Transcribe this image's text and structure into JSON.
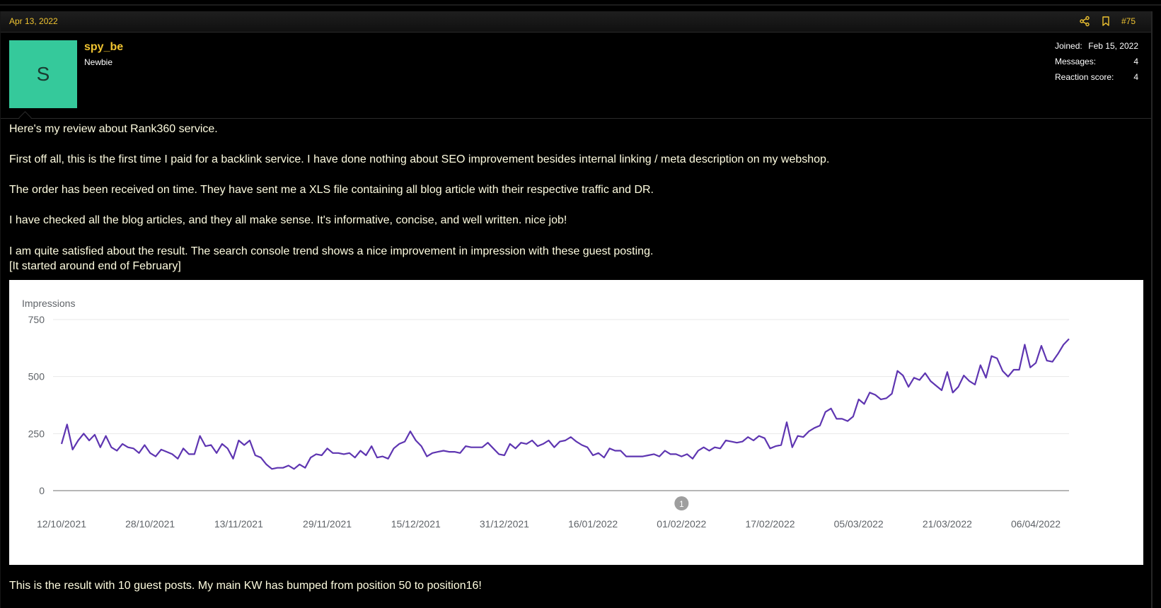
{
  "post": {
    "date": "Apr 13, 2022",
    "number": "#75",
    "share_icon": "share-icon",
    "bookmark_icon": "bookmark-icon",
    "accent_color": "#f0c431"
  },
  "user": {
    "avatar_letter": "S",
    "avatar_color": "#35c99b",
    "name": "spy_be",
    "title": "Newbie",
    "stats": [
      {
        "label": "Joined:",
        "value": "Feb 15, 2022"
      },
      {
        "label": "Messages:",
        "value": "4"
      },
      {
        "label": "Reaction score:",
        "value": "4"
      }
    ]
  },
  "message": {
    "paragraphs": [
      "Here's my review about Rank360 service.",
      "First off all, this is the first time I paid for a backlink service. I have done nothing about SEO improvement besides internal linking / meta description on my webshop.",
      "The order has been received on time. They have sent me a XLS file containing all blog article with their respective traffic and DR.",
      "I have checked all the blog articles, and they all make sense. It's informative, concise, and well written. nice job!",
      "I am quite satisfied about the result. The search console trend shows a nice improvement in impression with these guest posting.",
      "[It started around end of February]"
    ],
    "footer": "This is the result with 10 guest posts. My main KW has bumped from position 50 to position16!"
  },
  "chart_data": {
    "type": "line",
    "ylabel": "Impressions",
    "yticks": [
      0,
      250,
      500,
      750
    ],
    "ylim": [
      0,
      750
    ],
    "xticks": [
      "12/10/2021",
      "28/10/2021",
      "13/11/2021",
      "29/11/2021",
      "15/12/2021",
      "31/12/2021",
      "16/01/2022",
      "01/02/2022",
      "17/02/2022",
      "05/03/2022",
      "21/03/2022",
      "06/04/2022"
    ],
    "x_start": "12/10/2021",
    "x_end": "12/04/2022",
    "annotation": {
      "label": "1",
      "date": "01/02/2022"
    },
    "line_color": "#5e35b1",
    "series": [
      {
        "values": [
          205,
          290,
          180,
          220,
          250,
          220,
          245,
          190,
          240,
          190,
          175,
          205,
          190,
          185,
          165,
          200,
          165,
          150,
          180,
          170,
          160,
          140,
          185,
          160,
          160,
          240,
          195,
          200,
          165,
          205,
          185,
          140,
          220,
          200,
          220,
          155,
          145,
          115,
          95,
          100,
          100,
          110,
          95,
          115,
          100,
          145,
          160,
          155,
          185,
          165,
          165,
          160,
          165,
          145,
          175,
          155,
          195,
          145,
          150,
          140,
          185,
          205,
          215,
          260,
          220,
          195,
          150,
          165,
          170,
          175,
          170,
          170,
          165,
          195,
          190,
          190,
          190,
          210,
          185,
          160,
          155,
          205,
          185,
          210,
          205,
          220,
          195,
          205,
          220,
          190,
          215,
          220,
          235,
          215,
          200,
          190,
          155,
          165,
          145,
          185,
          175,
          175,
          150,
          150,
          150,
          150,
          155,
          160,
          150,
          175,
          160,
          160,
          150,
          160,
          140,
          175,
          190,
          175,
          190,
          185,
          220,
          215,
          210,
          215,
          235,
          220,
          240,
          230,
          185,
          195,
          200,
          300,
          190,
          240,
          235,
          260,
          275,
          285,
          345,
          360,
          315,
          315,
          305,
          325,
          400,
          380,
          430,
          420,
          400,
          405,
          425,
          525,
          505,
          455,
          495,
          485,
          515,
          480,
          460,
          440,
          520,
          430,
          455,
          505,
          480,
          465,
          550,
          495,
          590,
          580,
          525,
          500,
          530,
          530,
          640,
          540,
          560,
          635,
          570,
          565,
          600,
          640,
          665
        ]
      }
    ]
  }
}
